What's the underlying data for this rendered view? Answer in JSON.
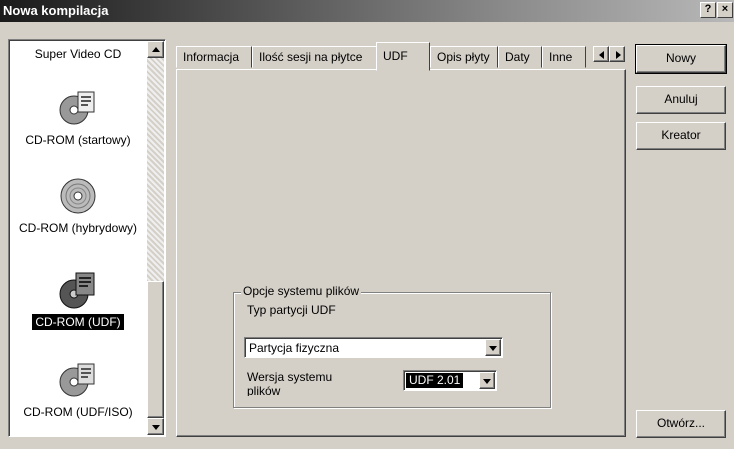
{
  "window": {
    "title": "Nowa kompilacja",
    "help_glyph": "?",
    "close_glyph": "×"
  },
  "project_list": {
    "items": [
      {
        "label": "Super Video CD",
        "icon": "video-cd-icon",
        "selected": false
      },
      {
        "label": "CD-ROM (startowy)",
        "icon": "boot-disc-icon",
        "selected": false
      },
      {
        "label": "CD-ROM (hybrydowy)",
        "icon": "hybrid-disc-icon",
        "selected": false
      },
      {
        "label": "CD-ROM (UDF)",
        "icon": "udf-disc-icon",
        "selected": true
      },
      {
        "label": "CD-ROM (UDF/ISO)",
        "icon": "udf-iso-disc-icon",
        "selected": false
      }
    ]
  },
  "tabs": [
    {
      "label": "Informacja",
      "active": false
    },
    {
      "label": "Ilość sesji na płytce",
      "active": false
    },
    {
      "label": "UDF",
      "active": true
    },
    {
      "label": "Opis płyty",
      "active": false
    },
    {
      "label": "Daty",
      "active": false
    },
    {
      "label": "Inne",
      "active": false
    }
  ],
  "udf_panel": {
    "group_label": "Opcje systemu plików",
    "partition_label": "Typ partycji UDF",
    "partition_value": "Partycja fizyczna",
    "version_label_line1": "Wersja systemu",
    "version_label_line2": "plików",
    "version_value": "UDF 2.01"
  },
  "buttons": {
    "new": "Nowy",
    "cancel": "Anuluj",
    "wizard": "Kreator",
    "open": "Otwórz..."
  }
}
